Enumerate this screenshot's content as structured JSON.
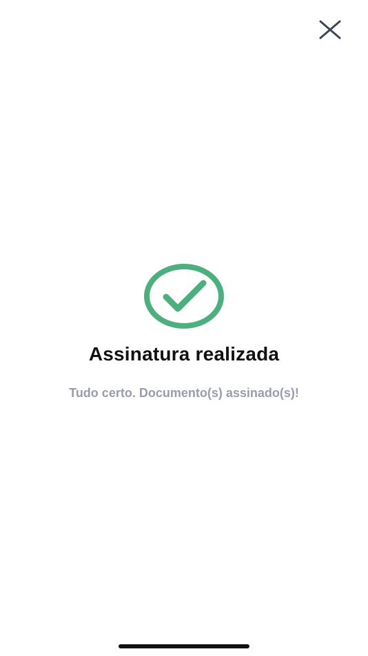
{
  "header": {
    "close_icon": "close-icon"
  },
  "status": {
    "icon": "check-circle-icon",
    "accent_color": "#4caf7d",
    "title": "Assinatura realizada",
    "message": "Tudo certo. Documento(s) assinado(s)!"
  },
  "colors": {
    "title": "#111111",
    "message": "#9a9cad",
    "close_icon": "#3d4453"
  }
}
